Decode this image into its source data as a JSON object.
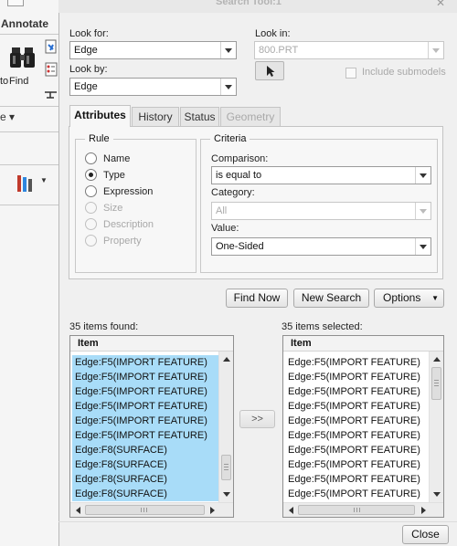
{
  "background_app": {
    "tab_label": "Annotate",
    "find_label": "Find",
    "partial_label": "to",
    "partial_label2": "e"
  },
  "dialog": {
    "title": "Search Tool:1",
    "look_for": {
      "label": "Look for:",
      "value": "Edge"
    },
    "look_in": {
      "label": "Look in:",
      "value": "800.PRT"
    },
    "look_by": {
      "label": "Look by:",
      "value": "Edge"
    },
    "include_submodels": "Include submodels",
    "tabs": [
      {
        "label": "Attributes"
      },
      {
        "label": "History"
      },
      {
        "label": "Status"
      },
      {
        "label": "Geometry"
      }
    ],
    "rule": {
      "title": "Rule",
      "options": [
        {
          "label": "Name"
        },
        {
          "label": "Type"
        },
        {
          "label": "Expression"
        },
        {
          "label": "Size"
        },
        {
          "label": "Description"
        },
        {
          "label": "Property"
        }
      ],
      "selected": "Type"
    },
    "criteria": {
      "title": "Criteria",
      "comparison_label": "Comparison:",
      "comparison_value": "is equal to",
      "category_label": "Category:",
      "category_value": "All",
      "value_label": "Value:",
      "value_value": "One-Sided"
    },
    "buttons": {
      "find_now": "Find Now",
      "new_search": "New Search",
      "options": "Options",
      "transfer": ">>",
      "close": "Close"
    },
    "found": {
      "label": "35 items found:",
      "header": "Item",
      "rows": [
        "Edge:F5(IMPORT FEATURE)",
        "Edge:F5(IMPORT FEATURE)",
        "Edge:F5(IMPORT FEATURE)",
        "Edge:F5(IMPORT FEATURE)",
        "Edge:F5(IMPORT FEATURE)",
        "Edge:F5(IMPORT FEATURE)",
        "Edge:F8(SURFACE)",
        "Edge:F8(SURFACE)",
        "Edge:F8(SURFACE)",
        "Edge:F8(SURFACE)"
      ]
    },
    "selected": {
      "label": "35 items selected:",
      "header": "Item",
      "rows": [
        "Edge:F5(IMPORT FEATURE)",
        "Edge:F5(IMPORT FEATURE)",
        "Edge:F5(IMPORT FEATURE)",
        "Edge:F5(IMPORT FEATURE)",
        "Edge:F5(IMPORT FEATURE)",
        "Edge:F5(IMPORT FEATURE)",
        "Edge:F5(IMPORT FEATURE)",
        "Edge:F5(IMPORT FEATURE)",
        "Edge:F5(IMPORT FEATURE)",
        "Edge:F5(IMPORT FEATURE)"
      ]
    },
    "colors": {
      "row_highlight": "#a8dcf8"
    }
  }
}
